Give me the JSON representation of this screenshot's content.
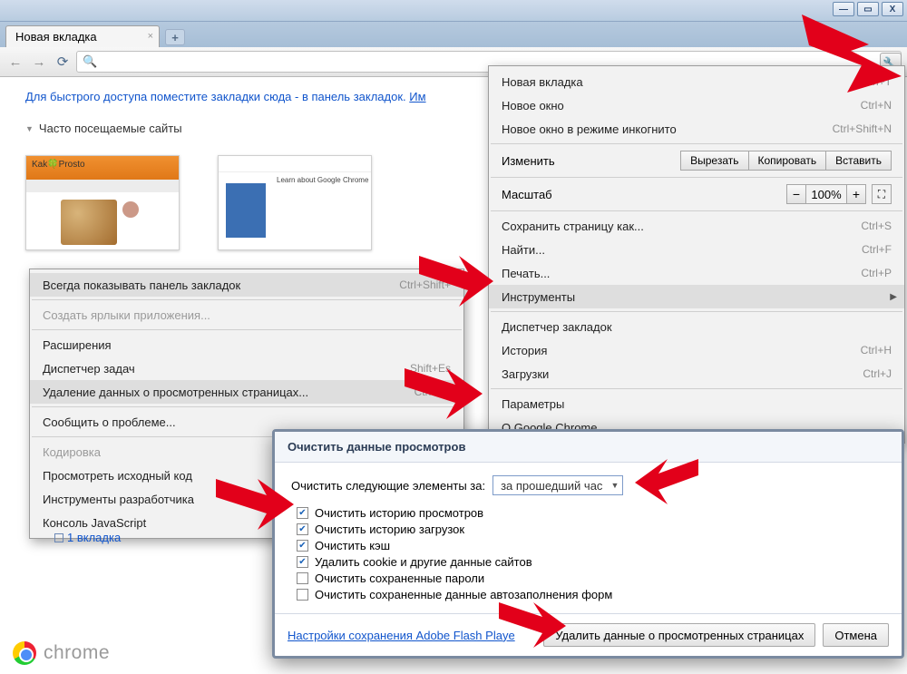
{
  "tab": {
    "title": "Новая вкладка"
  },
  "hint": "Для быстрого доступа поместите закладки сюда - в панель закладок.",
  "hint_link": "Им",
  "section_mv": "Часто посещаемые сайты",
  "thumb2_caption": "Learn about Google Chrome",
  "footer_word": "chrome",
  "one_tab": "1 вкладка",
  "menu": {
    "new_tab": "Новая вкладка",
    "new_tab_sc": "Ctrl+T",
    "new_win": "Новое окно",
    "new_win_sc": "Ctrl+N",
    "incog": "Новое окно в режиме инкогнито",
    "incog_sc": "Ctrl+Shift+N",
    "edit": "Изменить",
    "cut": "Вырезать",
    "copy": "Копировать",
    "paste": "Вставить",
    "zoom": "Масштаб",
    "zoom_val": "100%",
    "save": "Сохранить страницу как...",
    "save_sc": "Ctrl+S",
    "find": "Найти...",
    "find_sc": "Ctrl+F",
    "print": "Печать...",
    "print_sc": "Ctrl+P",
    "tools": "Инструменты",
    "bm_mgr": "Диспетчер закладок",
    "history": "История",
    "history_sc": "Ctrl+H",
    "downloads": "Загрузки",
    "downloads_sc": "Ctrl+J",
    "params": "Параметры",
    "about": "О Google Chrome"
  },
  "sub": {
    "always_show": "Всегда показывать панель закладок",
    "always_show_sc": "Ctrl+Shift+",
    "create_sc": "Создать ярлыки приложения...",
    "ext": "Расширения",
    "task": "Диспетчер задач",
    "task_sc": "Shift+Es",
    "clear": "Удаление данных о просмотренных страницах...",
    "clear_sc": "Ctrl+Sh",
    "report": "Сообщить о проблеме...",
    "encoding": "Кодировка",
    "view_src": "Просмотреть исходный код",
    "dev_tools": "Инструменты разработчика",
    "js_console": "Консоль JavaScript"
  },
  "dialog": {
    "title": "Очистить данные просмотров",
    "label": "Очистить следующие элементы за:",
    "period": "за прошедший час",
    "c1": "Очистить историю просмотров",
    "c2": "Очистить историю загрузок",
    "c3": "Очистить кэш",
    "c4": "Удалить cookie и другие данные сайтов",
    "c5": "Очистить сохраненные пароли",
    "c6": "Очистить сохраненные данные автозаполнения форм",
    "flash_link": "Настройки сохранения Adobe Flash Playe",
    "ok": "Удалить данные о просмотренных страницах",
    "cancel": "Отмена"
  }
}
